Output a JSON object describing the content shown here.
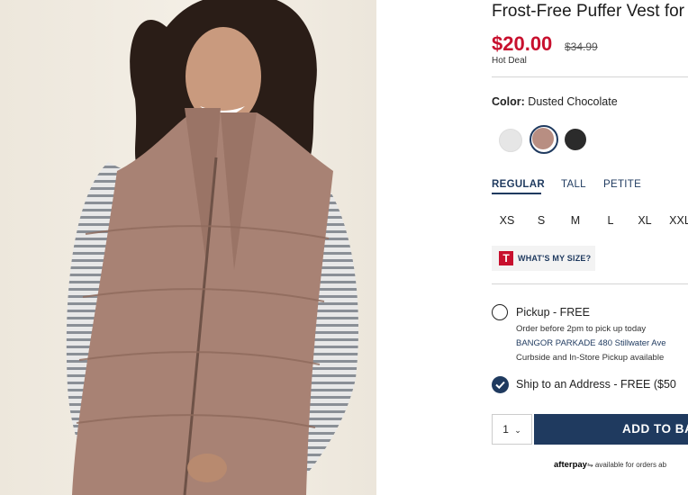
{
  "product": {
    "title": "Frost-Free Puffer Vest for",
    "price": "$20.00",
    "original_price": "$34.99",
    "deal_label": "Hot Deal"
  },
  "color": {
    "label": "Color:",
    "selected": "Dusted Chocolate",
    "swatches": [
      {
        "name": "light-grey",
        "color": "#e6e6e6"
      },
      {
        "name": "dusted-chocolate",
        "color": "#b88e82",
        "selected": true
      },
      {
        "name": "black",
        "color": "#2b2b2b"
      }
    ]
  },
  "fit_tabs": [
    "REGULAR",
    "TALL",
    "PETITE"
  ],
  "sizes": [
    "XS",
    "S",
    "M",
    "L",
    "XL",
    "XXL"
  ],
  "size_guide": {
    "icon_letter": "T",
    "label": "WHAT'S MY SIZE?"
  },
  "pickup": {
    "label": "Pickup - FREE",
    "note": "Order before 2pm to pick up today",
    "store": "BANGOR PARKADE 480 Stillwater Ave",
    "details": "Curbside and In-Store Pickup available"
  },
  "ship": {
    "label": "Ship to an Address - FREE ($50"
  },
  "quantity": "1",
  "add_to_bag": "ADD TO BA",
  "afterpay": {
    "brand": "afterpay",
    "text": "available for orders ab"
  },
  "colors": {
    "accent": "#1f3a5f",
    "price": "#c8102e"
  }
}
